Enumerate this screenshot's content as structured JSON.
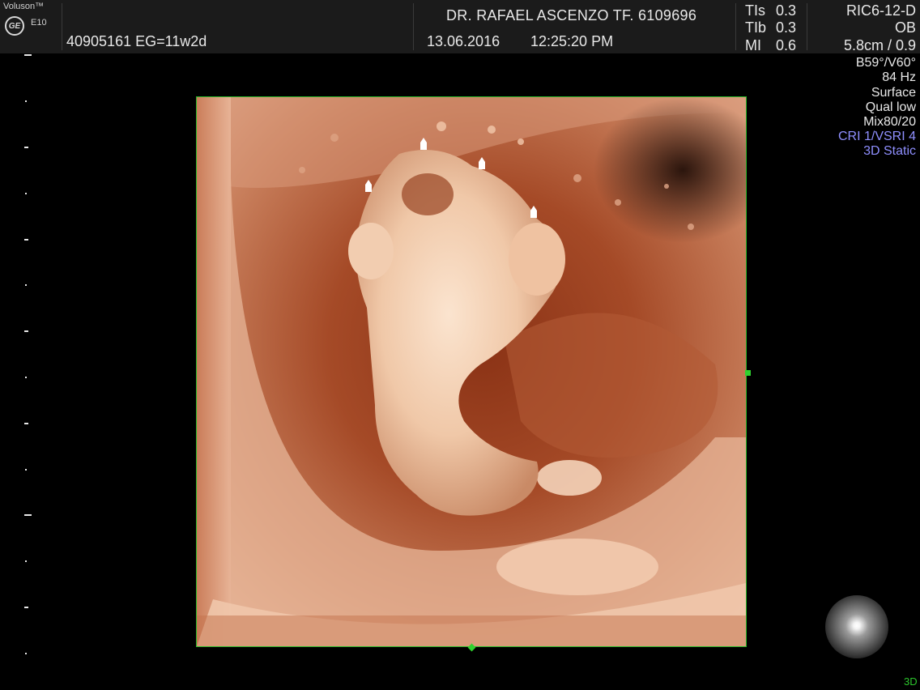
{
  "header": {
    "brand": "Voluson™",
    "model": "E10",
    "logo_icon": "ge-logo-icon",
    "patient_line": "40905161  EG=11w2d",
    "doctor": "DR. RAFAEL ASCENZO TF. 6109696",
    "date": "13.06.2016",
    "time": "12:25:20 PM",
    "indices": [
      {
        "label": "TIs",
        "value": "0.3"
      },
      {
        "label": "TIb",
        "value": "0.3"
      },
      {
        "label": "MI",
        "value": "0.6"
      }
    ],
    "probe": "RIC6-12-D",
    "preset": "OB",
    "depth": "5.8cm / 0.9"
  },
  "params": {
    "angles": "B59°/V60°",
    "frequency": "84 Hz",
    "render_mode": "Surface",
    "quality": "Qual low",
    "mix": "Mix80/20",
    "cri": "CRI 1/VSRI 4",
    "static": "3D Static",
    "highlight_color": "#8f8fff"
  },
  "viewport": {
    "image": "3D rendered fetal ultrasound volume",
    "frame_color": "#29b829",
    "pointer_icons": [
      "hand-pointer-icon",
      "hand-pointer-icon",
      "hand-pointer-icon",
      "hand-pointer-icon"
    ]
  },
  "footer": {
    "mode_label": "3D",
    "orientation_icon": "render-orientation-sphere-icon"
  }
}
